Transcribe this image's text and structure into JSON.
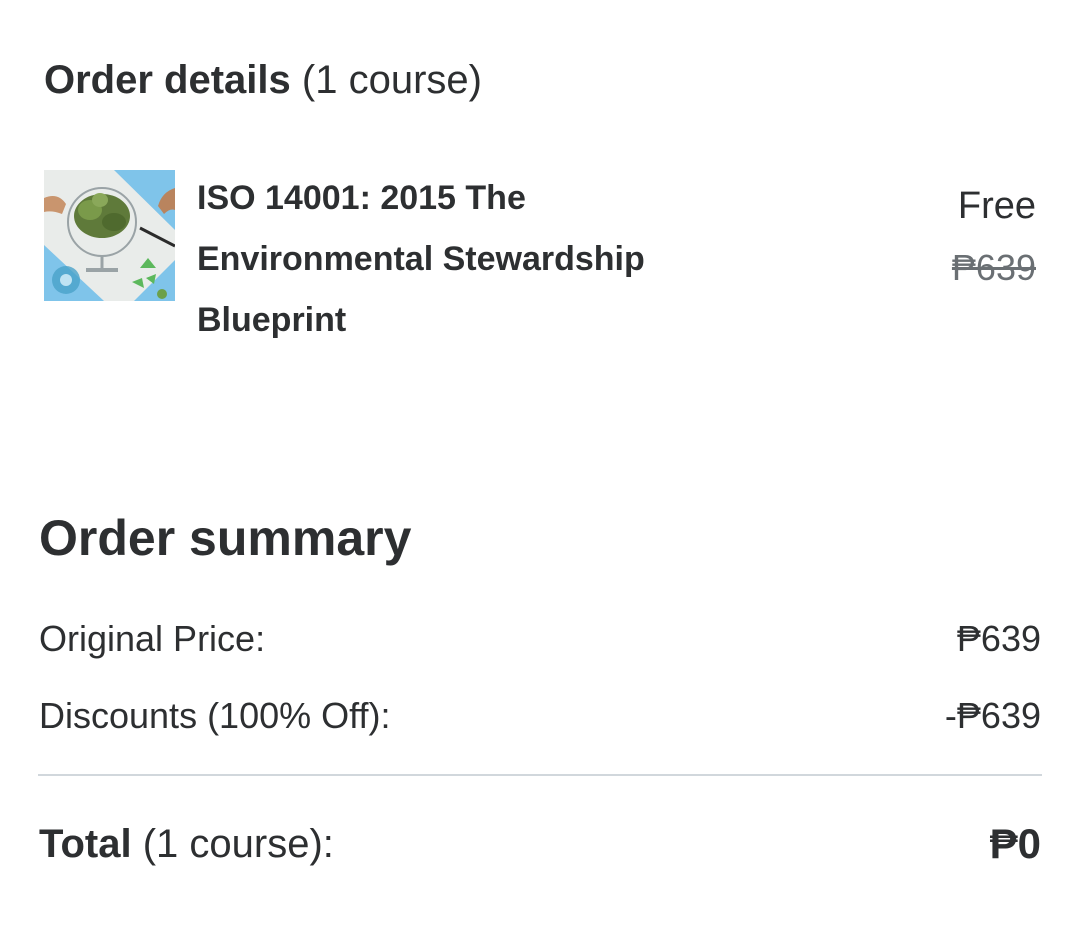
{
  "order_details": {
    "heading_strong": "Order details",
    "heading_count": "(1 course)"
  },
  "course": {
    "thumbnail_icon": "environment-globe-thumbnail",
    "title": "ISO 14001: 2015 The Environmental Stewardship Blueprint",
    "price_label": "Free",
    "original_price": "₱639"
  },
  "order_summary": {
    "heading": "Order summary",
    "original_price_label": "Original Price:",
    "original_price_value": "₱639",
    "discounts_label": "Discounts (100% Off):",
    "discounts_value": "-₱639",
    "total_label_strong": "Total",
    "total_label_count": "(1 course):",
    "total_value": "₱0"
  },
  "colors": {
    "text": "#2d2f31",
    "muted": "#6a6f73",
    "divider": "#d1d7dc",
    "thumb_blue": "#7fc4ea"
  }
}
